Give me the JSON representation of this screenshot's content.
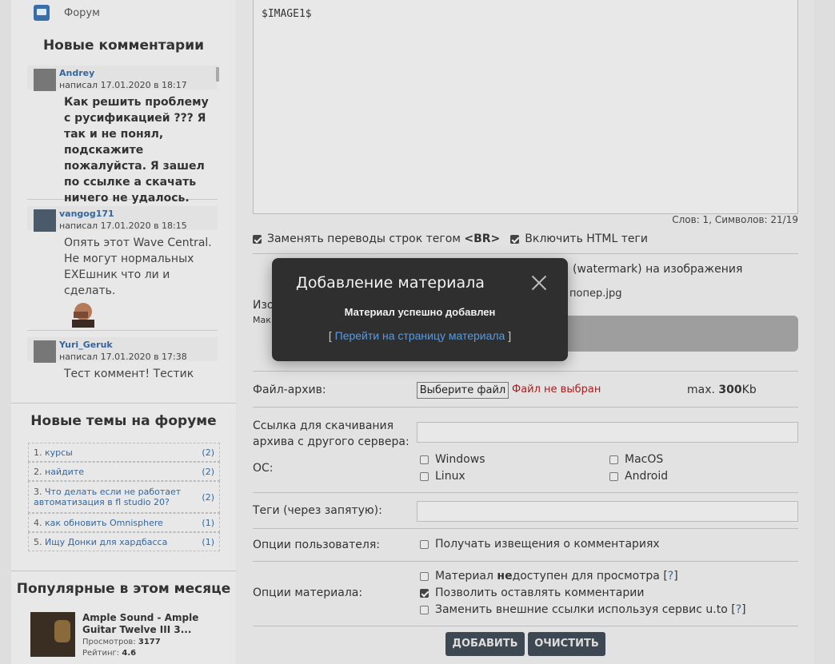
{
  "sidebar": {
    "forum_link": "Форум",
    "new_comments_title": "Новые комментарии",
    "comments": [
      {
        "user": "Andrey",
        "date": "написал 17.01.2020 в 18:17",
        "text": "Как решить проблему с русификацией ??? Я так и не понял, подскажите пожалуйста. Я зашел по ссылке а скачать ничего не удалось."
      },
      {
        "user": "vangog171",
        "date": "написал 17.01.2020 в 18:15",
        "text": "Опять этот Wave Central. Не могут нормальных EXEшник что ли и сделать."
      },
      {
        "user": "Yuri_Geruk",
        "date": "написал 17.01.2020 в 17:38",
        "text": "Тест коммент! Тестик"
      }
    ],
    "forum_topics_title": "Новые темы на форуме",
    "topics": [
      {
        "num": "1.",
        "title": "курсы",
        "count": "(2)"
      },
      {
        "num": "2.",
        "title": "найдите",
        "count": "(2)"
      },
      {
        "num": "3.",
        "title": "Что делать если не работает автоматизация в fl studio 20?",
        "count": "(2)"
      },
      {
        "num": "4.",
        "title": "как обновить Omnisphere",
        "count": "(1)"
      },
      {
        "num": "5.",
        "title": "Ищу Донки для хардбасса",
        "count": "(1)"
      }
    ],
    "popular_title": "Популярные в этом месяце",
    "popular": {
      "title": "Ample Sound - Ample Guitar Twelve III 3...",
      "views_label": "Просмотров:",
      "views": "3177",
      "rating_label": "Рейтинг:",
      "rating": "4.6"
    }
  },
  "editor": {
    "content": "$IMAGE1$",
    "counter": "Слов: 1, Символов: 21/19"
  },
  "options": {
    "replace_br_pre": "Заменять переводы строк тегом ",
    "replace_br_tag": "<BR>",
    "enable_html": "Включить HTML теги",
    "watermark_partial": "(watermark) на изображения",
    "file_partial": "попер.jpg",
    "image_label_partial": "Изо",
    "max_label_partial": "Мак"
  },
  "archive": {
    "label": "Файл-архив:",
    "choose_button": "Выберите файл",
    "no_file": "Файл не выбран",
    "max_prefix": "max. ",
    "max_value": "300",
    "max_unit": "Kb"
  },
  "download_link": {
    "label": "Ссылка для скачивания архива с другого сервера:",
    "value": ""
  },
  "os": {
    "label": "ОС:",
    "items": [
      "Windows",
      "MacOS",
      "Linux",
      "Android"
    ]
  },
  "tags": {
    "label": "Теги (через запятую):",
    "value": ""
  },
  "user_options": {
    "label": "Опции пользователя:",
    "notify": "Получать извещения о комментариях"
  },
  "material_options": {
    "label": "Опции материала:",
    "unavailable_pre": "Материал ",
    "unavailable_bold": "не",
    "unavailable_post": "доступен для просмотра",
    "allow_comments": "Позволить оставлять комментарии",
    "replace_links": "Заменить внешние ссылки используя сервис u.to",
    "help": "?",
    "bracket_open": "[",
    "bracket_close": "]"
  },
  "buttons": {
    "add": "ДОБАВИТЬ",
    "clear": "ОЧИСТИТЬ"
  },
  "modal": {
    "title": "Добавление материала",
    "message": "Материал успешно добавлен",
    "link_open": "[ ",
    "link": "Перейти на страницу материала",
    "link_close": " ]"
  }
}
